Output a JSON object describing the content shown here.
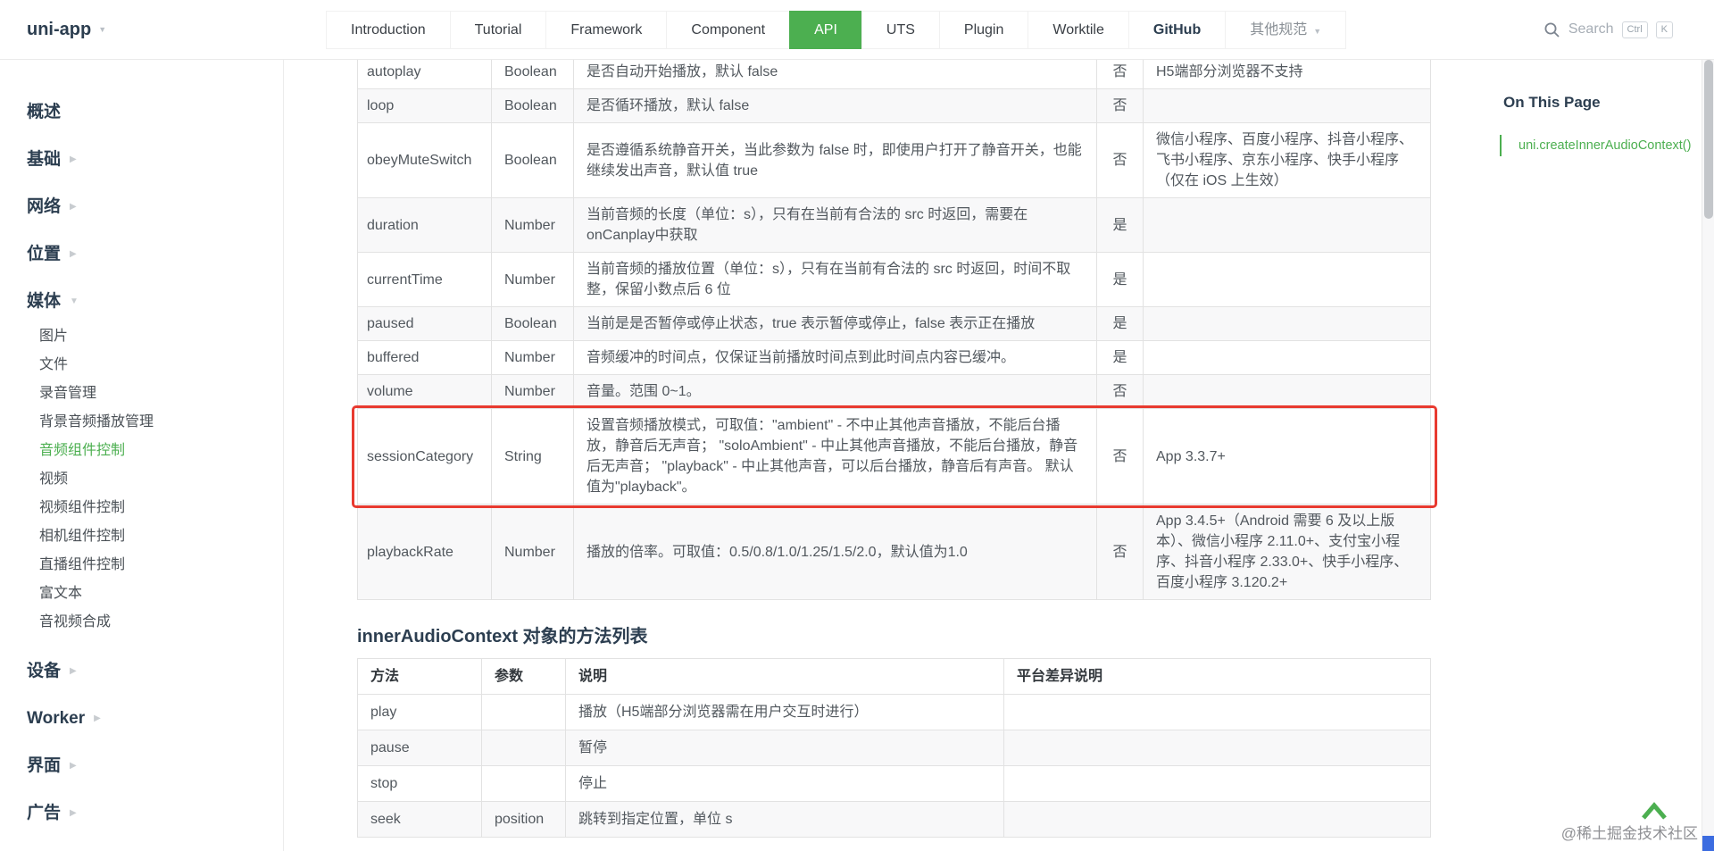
{
  "nav": {
    "logo": "uni-app",
    "items": [
      {
        "label": "Introduction"
      },
      {
        "label": "Tutorial"
      },
      {
        "label": "Framework"
      },
      {
        "label": "Component"
      },
      {
        "label": "API",
        "active": true
      },
      {
        "label": "UTS"
      },
      {
        "label": "Plugin"
      },
      {
        "label": "Worktile"
      },
      {
        "label": "GitHub",
        "bold": true
      },
      {
        "label": "其他规范",
        "muted": true,
        "caret": true
      }
    ],
    "search": {
      "placeholder": "Search",
      "keys": [
        "Ctrl",
        "K"
      ]
    }
  },
  "sidebar": {
    "items": [
      {
        "label": "概述"
      },
      {
        "label": "基础",
        "arrow": "right"
      },
      {
        "label": "网络",
        "arrow": "right"
      },
      {
        "label": "位置",
        "arrow": "right"
      },
      {
        "label": "媒体",
        "arrow": "down",
        "children": [
          {
            "label": "图片"
          },
          {
            "label": "文件"
          },
          {
            "label": "录音管理"
          },
          {
            "label": "背景音频播放管理"
          },
          {
            "label": "音频组件控制",
            "active": true
          },
          {
            "label": "视频"
          },
          {
            "label": "视频组件控制"
          },
          {
            "label": "相机组件控制"
          },
          {
            "label": "直播组件控制"
          },
          {
            "label": "富文本"
          },
          {
            "label": "音视频合成"
          }
        ]
      },
      {
        "label": "设备",
        "arrow": "right"
      },
      {
        "label": "Worker",
        "arrow": "right"
      },
      {
        "label": "界面",
        "arrow": "right"
      },
      {
        "label": "广告",
        "arrow": "right"
      }
    ]
  },
  "content": {
    "properties_table": {
      "rows": [
        {
          "name": "autoplay",
          "type": "Boolean",
          "desc": "是否自动开始播放，默认 false",
          "required": "否",
          "platform": "H5端部分浏览器不支持"
        },
        {
          "name": "loop",
          "type": "Boolean",
          "desc": "是否循环播放，默认 false",
          "required": "否",
          "platform": ""
        },
        {
          "name": "obeyMuteSwitch",
          "type": "Boolean",
          "desc": "是否遵循系统静音开关，当此参数为 false 时，即使用户打开了静音开关，也能继续发出声音，默认值 true",
          "required": "否",
          "platform": "微信小程序、百度小程序、抖音小程序、飞书小程序、京东小程序、快手小程序（仅在 iOS 上生效）"
        },
        {
          "name": "duration",
          "type": "Number",
          "desc": "当前音频的长度（单位：s），只有在当前有合法的 src 时返回，需要在 onCanplay中获取",
          "required": "是",
          "platform": ""
        },
        {
          "name": "currentTime",
          "type": "Number",
          "desc": "当前音频的播放位置（单位：s），只有在当前有合法的 src 时返回，时间不取整，保留小数点后 6 位",
          "required": "是",
          "platform": ""
        },
        {
          "name": "paused",
          "type": "Boolean",
          "desc": "当前是是否暂停或停止状态，true 表示暂停或停止，false 表示正在播放",
          "required": "是",
          "platform": ""
        },
        {
          "name": "buffered",
          "type": "Number",
          "desc": "音频缓冲的时间点，仅保证当前播放时间点到此时间点内容已缓冲。",
          "required": "是",
          "platform": ""
        },
        {
          "name": "volume",
          "type": "Number",
          "desc": "音量。范围 0~1。",
          "required": "否",
          "platform": ""
        },
        {
          "name": "sessionCategory",
          "type": "String",
          "desc": "设置音频播放模式，可取值：\"ambient\" - 不中止其他声音播放，不能后台播放，静音后无声音； \"soloAmbient\" - 中止其他声音播放，不能后台播放，静音后无声音； \"playback\" - 中止其他声音，可以后台播放，静音后有声音。 默认值为\"playback\"。",
          "required": "否",
          "platform": "App 3.3.7+",
          "highlighted": true
        },
        {
          "name": "playbackRate",
          "type": "Number",
          "desc": "播放的倍率。可取值：0.5/0.8/1.0/1.25/1.5/2.0，默认值为1.0",
          "required": "否",
          "platform": "App 3.4.5+（Android 需要 6 及以上版本）、微信小程序 2.11.0+、支付宝小程序、抖音小程序 2.33.0+、快手小程序、百度小程序 3.120.2+"
        }
      ]
    },
    "methods_heading": "innerAudioContext 对象的方法列表",
    "methods_table": {
      "headers": [
        "方法",
        "参数",
        "说明",
        "平台差异说明"
      ],
      "rows": [
        {
          "method": "play",
          "param": "",
          "desc": "播放（H5端部分浏览器需在用户交互时进行）",
          "platform": ""
        },
        {
          "method": "pause",
          "param": "",
          "desc": "暂停",
          "platform": ""
        },
        {
          "method": "stop",
          "param": "",
          "desc": "停止",
          "platform": ""
        },
        {
          "method": "seek",
          "param": "position",
          "desc": "跳转到指定位置，单位 s",
          "platform": ""
        }
      ]
    }
  },
  "toc": {
    "title": "On This Page",
    "links": [
      "uni.createInnerAudioContext()"
    ]
  },
  "watermark": "@稀土掘金技术社区",
  "colors": {
    "accent_green": "#4caf50",
    "highlight_red": "#e83a30",
    "scrollbar_marker_blue": "#3c6ce0"
  }
}
